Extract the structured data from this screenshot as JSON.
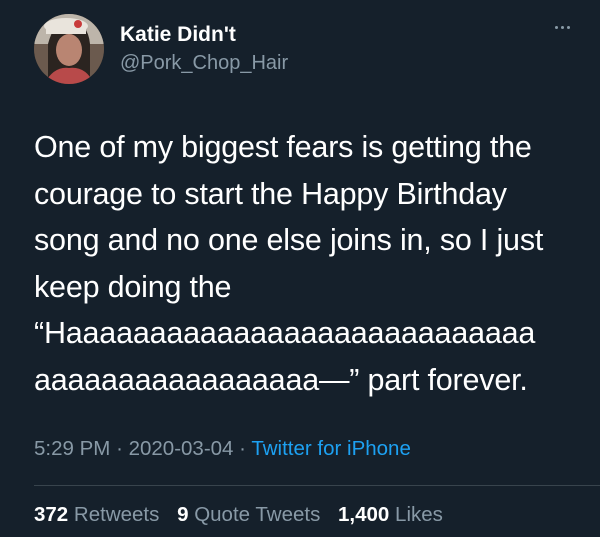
{
  "author": {
    "display_name": "Katie Didn't",
    "handle": "@Pork_Chop_Hair",
    "avatar_icon": "user-avatar-photo"
  },
  "tweet": {
    "lines": [
      "One of my biggest fears is getting the",
      "courage to start the Happy Birthday",
      "song and no one else joins in, so I just",
      "keep doing the",
      "“Haaaaaaaaaaaaaaaaaaaaaaaaaaaa",
      "aaaaaaaaaaaaaaaaa—” part forever."
    ]
  },
  "meta": {
    "time": "5:29 PM",
    "separator": "·",
    "date": "2020-03-04",
    "source": "Twitter for iPhone"
  },
  "stats": {
    "retweets_count": "372",
    "retweets_label": "Retweets",
    "quotes_count": "9",
    "quotes_label": "Quote Tweets",
    "likes_count": "1,400",
    "likes_label": "Likes"
  },
  "colors": {
    "background": "#15202b",
    "text": "#ffffff",
    "secondary": "#8899a6",
    "link": "#1da1f2",
    "divider": "#38444d"
  }
}
